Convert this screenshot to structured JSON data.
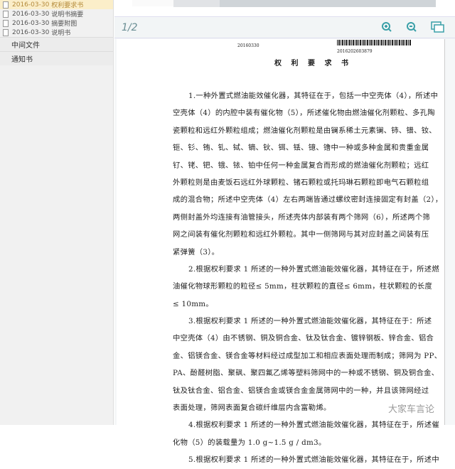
{
  "sidebar": {
    "files": [
      {
        "date": "2016-03-30",
        "name": "权利要求书",
        "selected": true
      },
      {
        "date": "2016-03-30",
        "name": "说明书摘要"
      },
      {
        "date": "2016-03-30",
        "name": "摘要附图"
      },
      {
        "date": "2016-03-30",
        "name": "说明书"
      }
    ],
    "groups": [
      "中间文件",
      "通知书"
    ]
  },
  "toolbar": {
    "page": "1/2",
    "zoom_in": "zoom-in",
    "zoom_out": "zoom-out",
    "view": "view-toggle"
  },
  "document": {
    "date": "20160330",
    "application_no": "2016202603879",
    "title": "权 利 要 求 书",
    "lines": [
      "1.一种外置式燃油能效催化器，其特征在于，包括一中空壳体（4），所述中",
      "空壳体（4）的内腔中装有催化物（5），所述催化物由燃油催化剂颗粒、多孔陶",
      "瓷颗粒和远红外颗粒组成；燃油催化剂颗粒是由镧系稀土元素镧、铈、镨、钕、",
      "钷、钐、铕、钆、铽、镝、钬、铒、铥、镱、镥中一种或多种金属和贵重金属",
      "钌、铑、钯、锇、铱、铂中任何一种金属复合而形成的燃油催化剂颗粒；远红",
      "外颗粒则是由麦饭石远红外球颗粒、锗石颗粒或托玛琳石颗粒即电气石颗粒组",
      "成的混合物；所述中空壳体（4）左右两端皆通过螺纹密封连接固定有封盖（2），",
      "两侧封盖外均连接有油管接头，所述壳体内部装有两个筛网（6），所述两个筛",
      "网之间装有催化剂颗粒和远红外颗粒。其中一侧筛网与其对应封盖之间装有压",
      "紧弹簧（3）。",
      "2.根据权利要求 1 所述的一种外置式燃油能效催化器，其特征在于，所述燃",
      "油催化物球形颗粒的粒径≤ 5mm，柱状颗粒的直径≤ 6mm，柱状颗粒的长度",
      "≤ 10mm。",
      "3.根据权利要求 1 所述的一种外置式燃油能效催化器，其特征在于：所述",
      "中空壳体（4）由不锈钢、铜及铜合金、钛及钛合金、镀锌钢板、锌合金、铝合",
      "金、铝镁合金、镁合金等材料经过成型加工和相应表面处理而制成；筛网为 PP、",
      "PA、酚醛树脂、聚砜、聚四氟乙烯等塑料筛网中的一种或不锈钢、铜及铜合金、",
      "钛及钛合金、铝合金、铝镁合金或镁合金金属筛网中的一种，并且该筛网经过",
      "表面处理，筛网表面复合碳纤维层内含富勒烯。",
      "4.根据权利要求 1 所述的一种外置式燃油能效催化器，其特征在于，所述催",
      "化物（5）的装载量为 1.0 g~1.5 g / dm3。",
      "5.根据权利要求 1 所述的一种外置式燃油能效催化器，其特征在于，所述中"
    ],
    "indented": [
      0,
      10,
      13,
      19,
      21
    ]
  },
  "watermark": "大家车言论"
}
